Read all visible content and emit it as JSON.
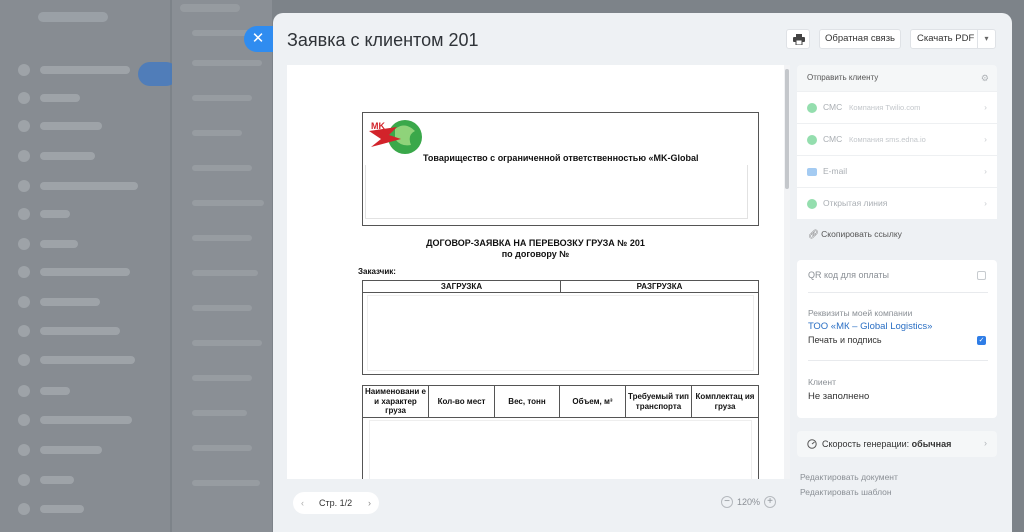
{
  "modal": {
    "title": "Заявка с клиентом 201",
    "close_icon": "close-icon",
    "print_icon": "printer-icon",
    "feedback_label": "Обратная связь",
    "pdf_label": "Скачать PDF"
  },
  "document": {
    "company_line": "Товарищество с ограниченной ответственностью «MK-Global",
    "title_line1": "ДОГОВОР-ЗАЯВКА НА ПЕРЕВОЗКУ ГРУЗА № 201",
    "title_line2": "по договору №",
    "customer_label": "Заказчик:",
    "loading_header": "ЗАГРУЗКА",
    "unloading_header": "РАЗГРУЗКА",
    "goods_columns": [
      "Наименовани е и характер груза",
      "Кол-во мест",
      "Вес, тонн",
      "Объем, м³",
      "Требуемый тип транспорта",
      "Комплектац ия груза"
    ]
  },
  "viewer": {
    "page_indicator": "Стр. 1/2",
    "zoom_level": "120%"
  },
  "send": {
    "title": "Отправить клиенту",
    "items": [
      {
        "label": "СМС",
        "sub": "Компания Twilio.com",
        "icon_color": "#3cc26b"
      },
      {
        "label": "СМС",
        "sub": "Компания sms.edna.io",
        "icon_color": "#3cc26b"
      },
      {
        "label": "E-mail",
        "sub": "",
        "icon_color": "#5aa0e8"
      },
      {
        "label": "Открытая линия",
        "sub": "",
        "icon_color": "#3cc26b"
      }
    ],
    "copy_link": "Скопировать ссылку"
  },
  "settings": {
    "qr_label": "QR код для оплаты",
    "requisites_label": "Реквизиты моей компании",
    "company_name": "ТОО «МК – Global Logistics»",
    "sign_label": "Печать и подпись",
    "sign_checked": true,
    "client_label": "Клиент",
    "client_value": "Не заполнено"
  },
  "speed": {
    "label": "Скорость генерации:",
    "value": "обычная"
  },
  "links": {
    "edit_document": "Редактировать документ",
    "edit_template": "Редактировать шаблон"
  },
  "colors": {
    "accent": "#2f8cf0",
    "link": "#2a6fc4"
  }
}
